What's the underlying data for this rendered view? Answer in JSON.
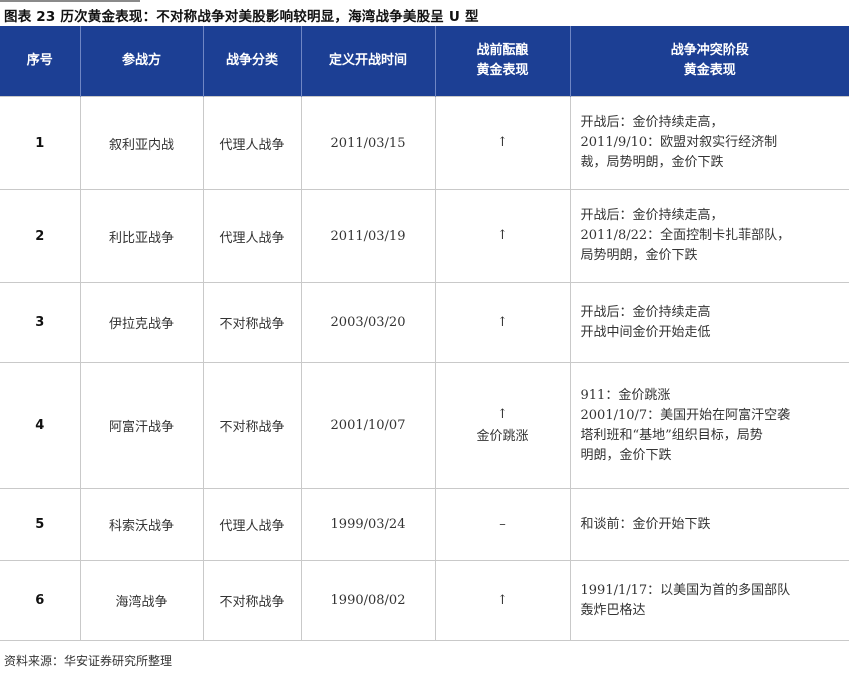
{
  "title": "图表 23 历次黄金表现：不对称战争对美股影响较明显，海湾战争美股呈 U 型",
  "columns": [
    "序号",
    "参战方",
    "战争分类",
    "定义开战时间",
    "战前黄金表现",
    "战争冲突阶段黄金表现"
  ],
  "header_lines": {
    "pre_war_gold": [
      "战前酝酿",
      "黄金表现"
    ],
    "conflict_gold": [
      "战争冲突阶段",
      "黄金表现"
    ]
  },
  "rows": [
    {
      "no": "1",
      "party": "叙利亚内战",
      "type": "代理人战争",
      "date": "2011/03/15",
      "pre_gold": "↑",
      "stage": "开战后：金价持续走高，\n2011/9/10：欧盟对叙实行经济制\n裁，局势明朗，金价下跌"
    },
    {
      "no": "2",
      "party": "利比亚战争",
      "type": "代理人战争",
      "date": "2011/03/19",
      "pre_gold": "↑",
      "stage": "开战后：金价持续走高，\n2011/8/22：全面控制卡扎菲部队，\n局势明朗，金价下跌"
    },
    {
      "no": "3",
      "party": "伊拉克战争",
      "type": "不对称战争",
      "date": "2003/03/20",
      "pre_gold": "↑",
      "stage": "开战后：金价持续走高\n开战中间金价开始走低"
    },
    {
      "no": "4",
      "party": "阿富汗战争",
      "type": "不对称战争",
      "date": "2001/10/07",
      "pre_gold": "↑\n金价跳涨",
      "stage": "911：金价跳涨\n2001/10/7：美国开始在阿富汗空袭\n塔利班和“基地”组织目标，局势\n明朗，金价下跌"
    },
    {
      "no": "5",
      "party": "科索沃战争",
      "type": "代理人战争",
      "date": "1999/03/24",
      "pre_gold": "–",
      "stage": "和谈前：金价开始下跌"
    },
    {
      "no": "6",
      "party": "海湾战争",
      "type": "不对称战争",
      "date": "1990/08/02",
      "pre_gold": "↑",
      "stage": "1991/1/17：以美国为首的多国部队\n轰炸巴格达"
    }
  ],
  "source": "资料来源：华安证券研究所整理"
}
